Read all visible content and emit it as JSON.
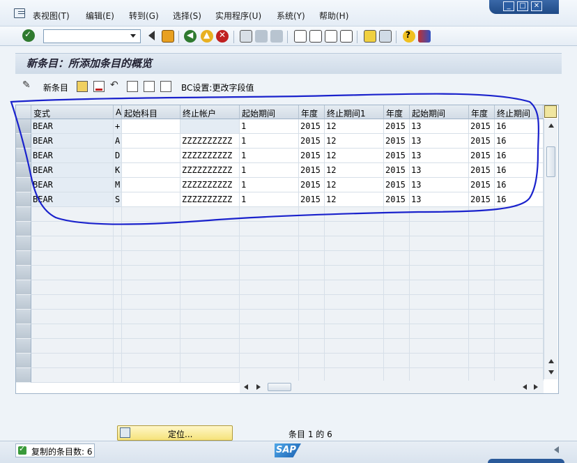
{
  "menubar": {
    "items": [
      "表视图(T)",
      "编辑(E)",
      "转到(G)",
      "选择(S)",
      "实用程序(U)",
      "系统(Y)",
      "帮助(H)"
    ]
  },
  "toolbar": {
    "command_field": "",
    "icons": [
      "enter-icon",
      "back-icon",
      "exit-icon",
      "cancel-icon",
      "print-icon",
      "find-icon",
      "find-next-icon",
      "first-page-icon",
      "prev-page-icon",
      "next-page-icon",
      "last-page-icon",
      "create-session-icon",
      "shortcut-icon",
      "help-icon",
      "layout-icon"
    ]
  },
  "title": "新条目：所添加条目的概览",
  "app_toolbar": {
    "new_entries": "新条目",
    "bc_settings": "BC设置:更改字段值"
  },
  "table": {
    "headers": [
      "变式",
      "A",
      "起始科目",
      "终止帐户",
      "起始期间",
      "年度",
      "终止期间1",
      "年度",
      "起始期间",
      "年度",
      "终止期间"
    ],
    "rows": [
      [
        "BEAR",
        "+",
        "",
        "",
        "1",
        "2015",
        "12",
        "2015",
        "13",
        "2015",
        "16"
      ],
      [
        "BEAR",
        "A",
        "",
        "ZZZZZZZZZZ",
        "1",
        "2015",
        "12",
        "2015",
        "13",
        "2015",
        "16"
      ],
      [
        "BEAR",
        "D",
        "",
        "ZZZZZZZZZZ",
        "1",
        "2015",
        "12",
        "2015",
        "13",
        "2015",
        "16"
      ],
      [
        "BEAR",
        "K",
        "",
        "ZZZZZZZZZZ",
        "1",
        "2015",
        "12",
        "2015",
        "13",
        "2015",
        "16"
      ],
      [
        "BEAR",
        "M",
        "",
        "ZZZZZZZZZZ",
        "1",
        "2015",
        "12",
        "2015",
        "13",
        "2015",
        "16"
      ],
      [
        "BEAR",
        "S",
        "",
        "ZZZZZZZZZZ",
        "1",
        "2015",
        "12",
        "2015",
        "13",
        "2015",
        "16"
      ]
    ],
    "empty_rows": 12
  },
  "position_button": "定位...",
  "entry_count": "条目 1 的 6",
  "status": {
    "message": "复制的条目数: 6"
  },
  "sap_logo": "SAP",
  "colors": {
    "annotation": "#1a22cc",
    "accent": "#1f4a86"
  }
}
